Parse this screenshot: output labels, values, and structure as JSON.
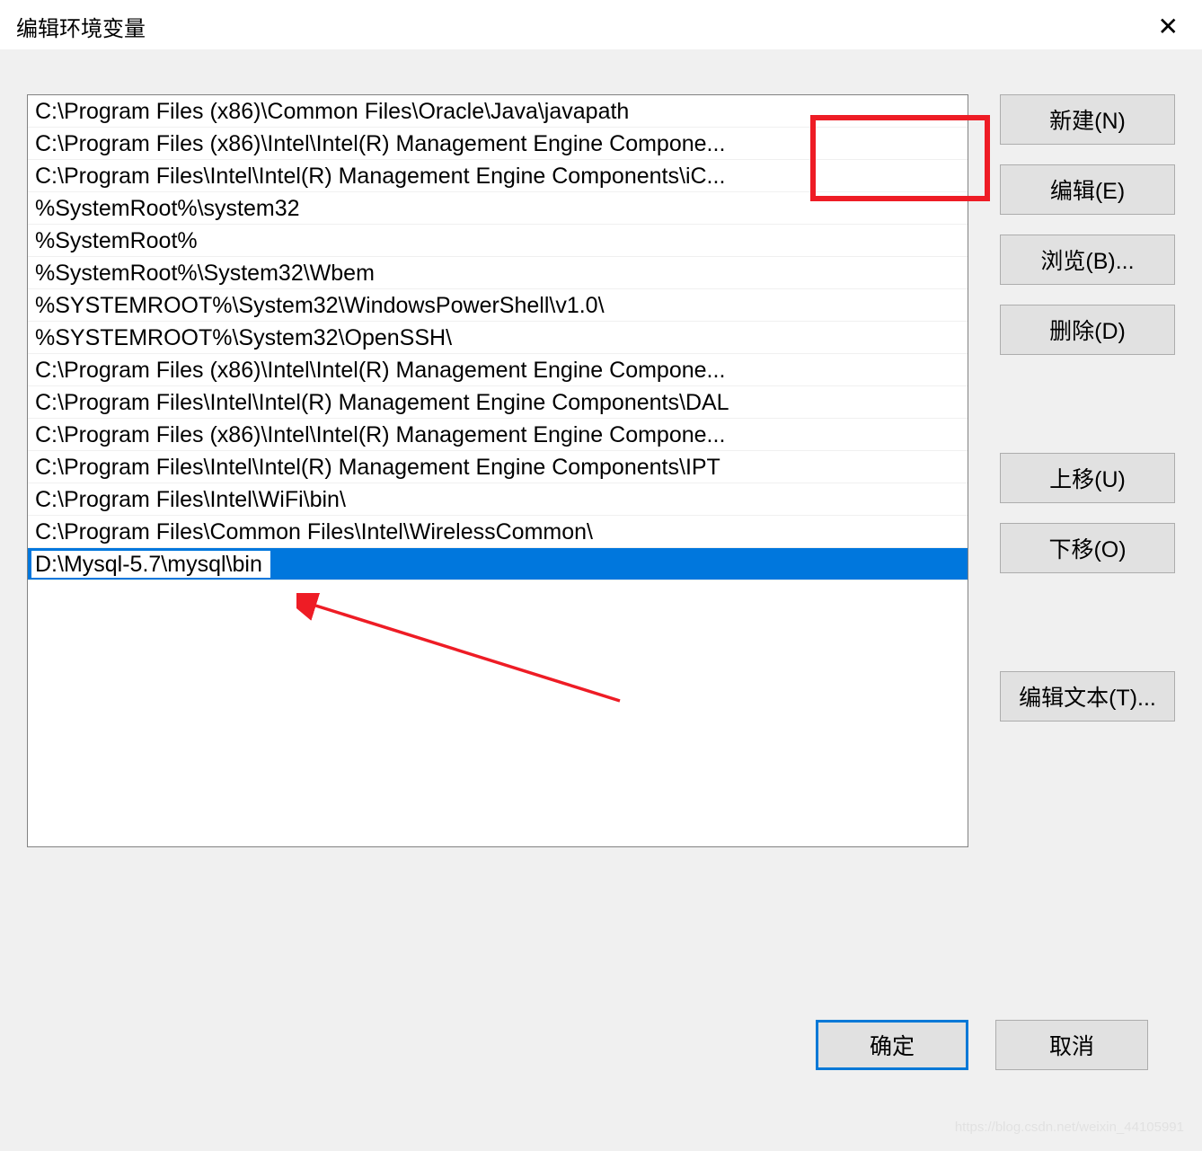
{
  "titlebar": {
    "title": "编辑环境变量"
  },
  "list": {
    "items": [
      "C:\\Program Files (x86)\\Common Files\\Oracle\\Java\\javapath",
      "C:\\Program Files (x86)\\Intel\\Intel(R) Management Engine Compone...",
      "C:\\Program Files\\Intel\\Intel(R) Management Engine Components\\iC...",
      "%SystemRoot%\\system32",
      "%SystemRoot%",
      "%SystemRoot%\\System32\\Wbem",
      "%SYSTEMROOT%\\System32\\WindowsPowerShell\\v1.0\\",
      "%SYSTEMROOT%\\System32\\OpenSSH\\",
      "C:\\Program Files (x86)\\Intel\\Intel(R) Management Engine Compone...",
      "C:\\Program Files\\Intel\\Intel(R) Management Engine Components\\DAL",
      "C:\\Program Files (x86)\\Intel\\Intel(R) Management Engine Compone...",
      "C:\\Program Files\\Intel\\Intel(R) Management Engine Components\\IPT",
      "C:\\Program Files\\Intel\\WiFi\\bin\\",
      "C:\\Program Files\\Common Files\\Intel\\WirelessCommon\\"
    ],
    "editing_value": "D:\\Mysql-5.7\\mysql\\bin"
  },
  "buttons": {
    "new": "新建(N)",
    "edit": "编辑(E)",
    "browse": "浏览(B)...",
    "delete": "删除(D)",
    "moveup": "上移(U)",
    "movedown": "下移(O)",
    "edittext": "编辑文本(T)..."
  },
  "footer": {
    "ok": "确定",
    "cancel": "取消"
  },
  "watermark": "https://blog.csdn.net/weixin_44105991"
}
